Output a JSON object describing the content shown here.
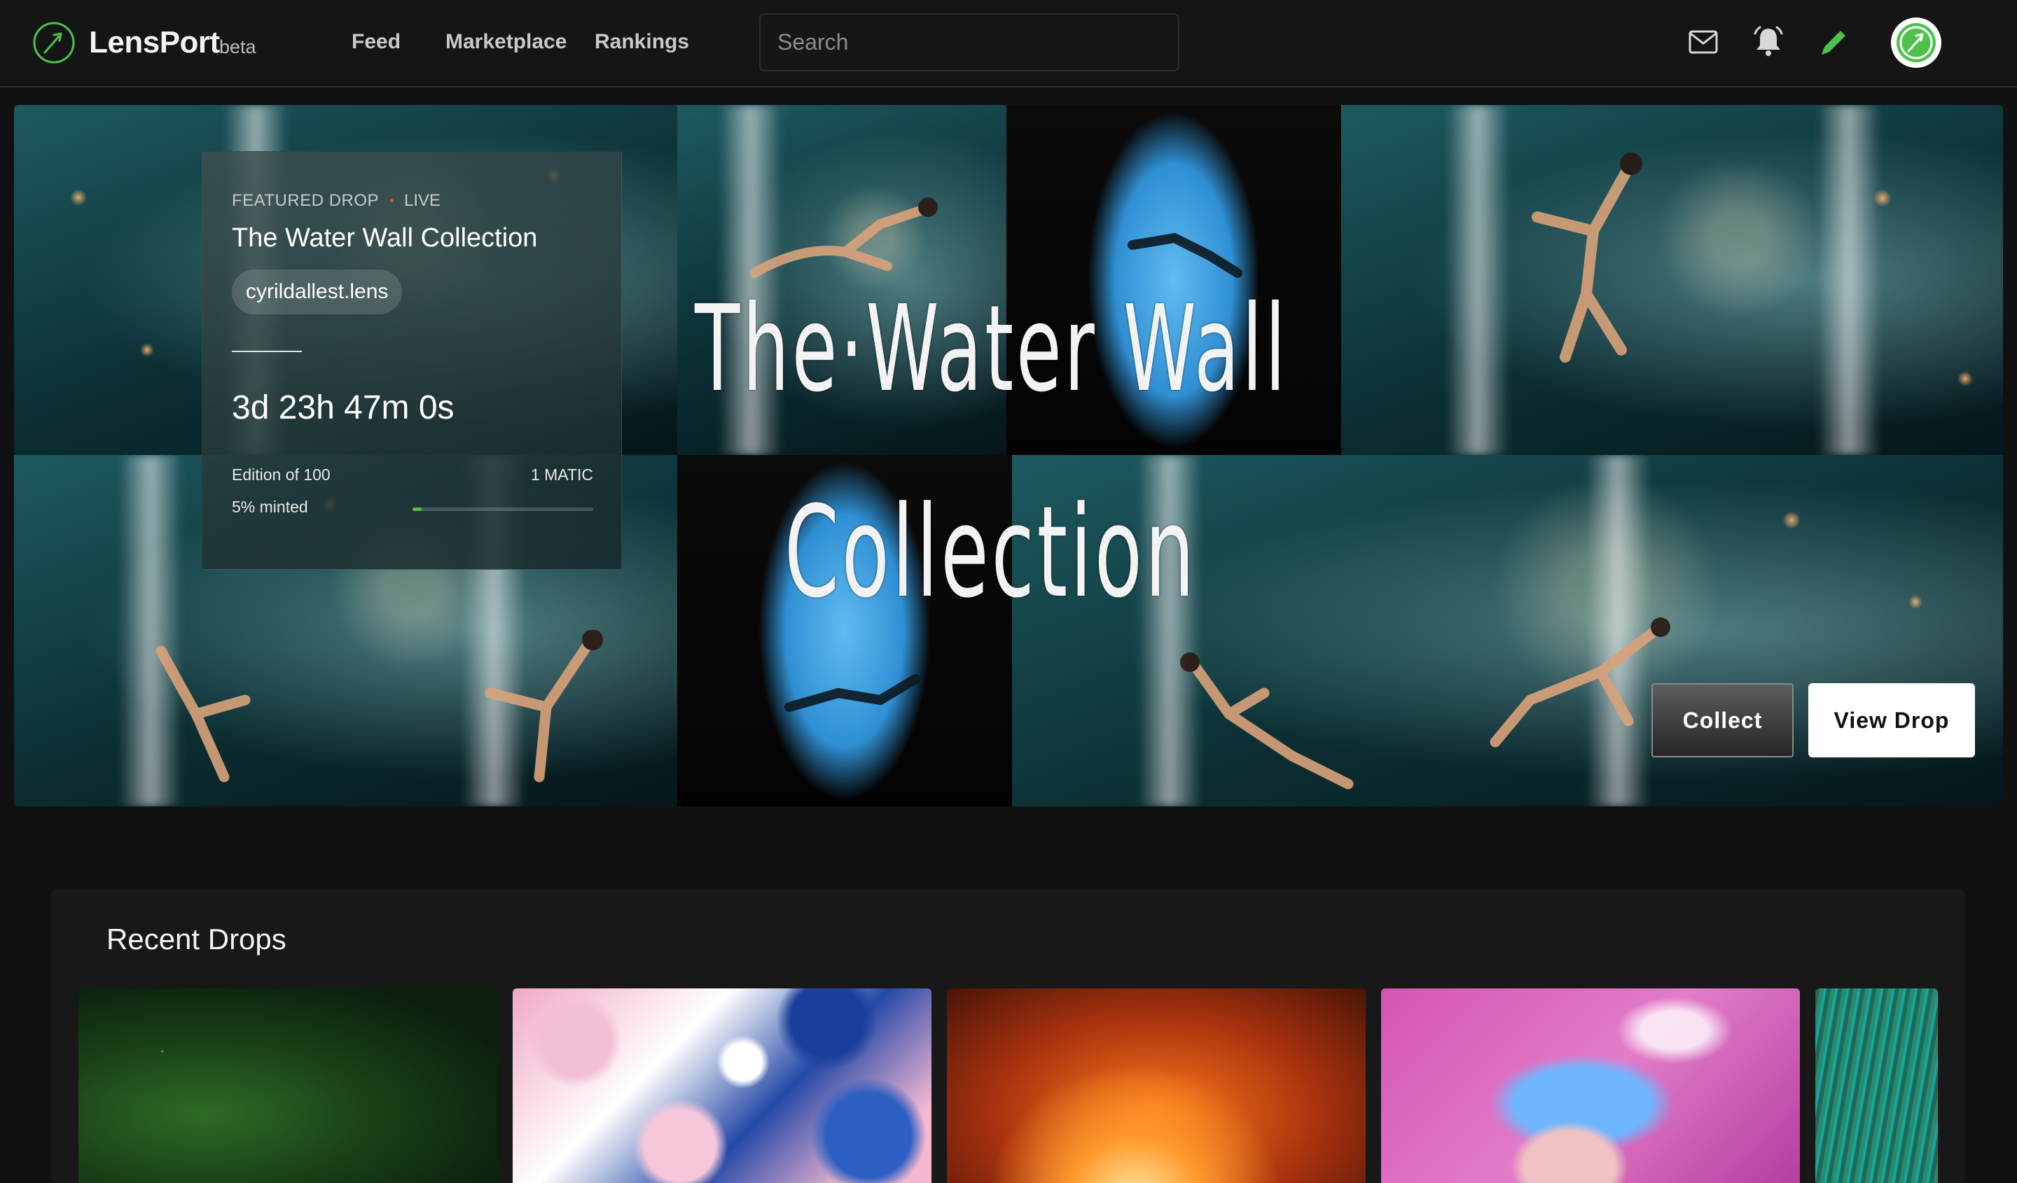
{
  "brand": {
    "name": "LensPort",
    "tag": "beta",
    "accent": "#4cc24a"
  },
  "nav": [
    {
      "label": "Feed"
    },
    {
      "label": "Marketplace"
    },
    {
      "label": "Rankings"
    }
  ],
  "search": {
    "placeholder": "Search",
    "value": ""
  },
  "header_icons": [
    "mail-icon",
    "bell-icon",
    "pencil-icon",
    "avatar"
  ],
  "hero": {
    "art_text_line1": "The·Water Wall",
    "art_text_line2": "Collection",
    "featured": {
      "eyebrow": "FEATURED DROP",
      "status": "LIVE",
      "status_color": "#e0503d",
      "title": "The Water Wall Collection",
      "author": "cyrildallest.lens",
      "countdown": "3d 23h 47m 0s",
      "edition": "Edition of 100",
      "price": "1 MATIC",
      "minted_label": "5% minted",
      "minted_fraction": 0.05
    },
    "actions": {
      "collect": "Collect",
      "view": "View Drop"
    }
  },
  "recent": {
    "title": "Recent Drops",
    "items": [
      {
        "name": "aurora"
      },
      {
        "name": "pink-blue-fluid"
      },
      {
        "name": "fire-crowd"
      },
      {
        "name": "blue-hair-portrait"
      },
      {
        "name": "green-waves"
      }
    ]
  }
}
